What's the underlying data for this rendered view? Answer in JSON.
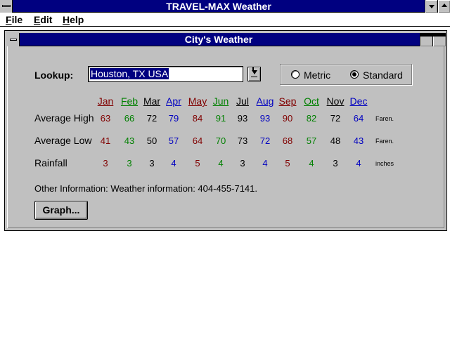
{
  "app": {
    "title": "TRAVEL-MAX Weather"
  },
  "menu": [
    {
      "label": "File"
    },
    {
      "label": "Edit"
    },
    {
      "label": "Help"
    }
  ],
  "child_window": {
    "title": "City's Weather"
  },
  "lookup": {
    "label": "Lookup:",
    "value": "Houston, TX USA"
  },
  "units": {
    "options": [
      {
        "label": "Metric",
        "selected": false
      },
      {
        "label": "Standard",
        "selected": true
      }
    ]
  },
  "months": [
    "Jan",
    "Feb",
    "Mar",
    "Apr",
    "May",
    "Jun",
    "Jul",
    "Aug",
    "Sep",
    "Oct",
    "Nov",
    "Dec"
  ],
  "month_colors": [
    "#800000",
    "#008000",
    "#000000",
    "#0000c0",
    "#800000",
    "#008000",
    "#000000",
    "#0000c0",
    "#800000",
    "#008000",
    "#000000",
    "#0000c0"
  ],
  "rows": [
    {
      "label": "Average High",
      "values": [
        "63",
        "66",
        "72",
        "79",
        "84",
        "91",
        "93",
        "93",
        "90",
        "82",
        "72",
        "64"
      ],
      "unit": "Faren."
    },
    {
      "label": "Average Low",
      "values": [
        "41",
        "43",
        "50",
        "57",
        "64",
        "70",
        "73",
        "72",
        "68",
        "57",
        "48",
        "43"
      ],
      "unit": "Faren."
    },
    {
      "label": "Rainfall",
      "values": [
        "3",
        "3",
        "3",
        "4",
        "5",
        "4",
        "3",
        "4",
        "5",
        "4",
        "3",
        "4"
      ],
      "unit": "inches"
    }
  ],
  "other_info": "Other Information:  Weather information:  404-455-7141.",
  "graph_button": "Graph..."
}
